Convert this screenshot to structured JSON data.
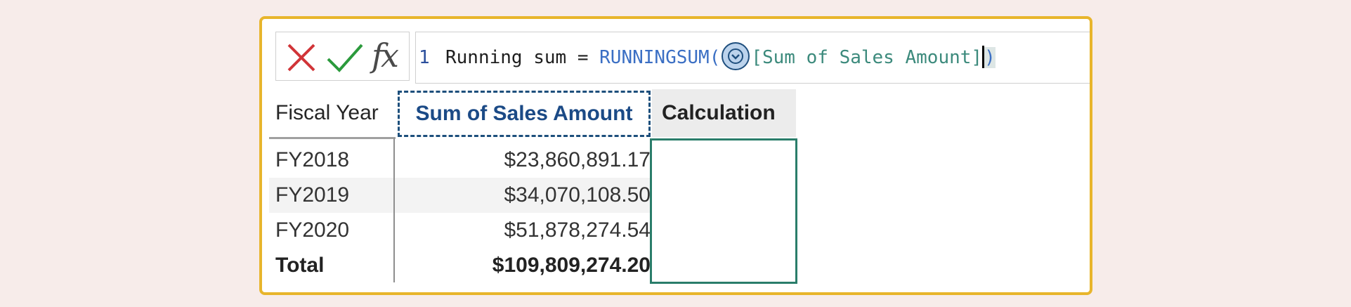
{
  "formula_bar": {
    "line_number": "1",
    "measure_name": "Running sum = ",
    "function_name": "RUNNINGSUM(",
    "argument": "[Sum of Sales Amount]",
    "close_paren": ")",
    "cancel_icon": "x-icon",
    "commit_icon": "check-icon",
    "fx_label": "fx"
  },
  "table": {
    "headers": {
      "fiscal_year": "Fiscal Year",
      "sum": "Sum of Sales Amount",
      "calculation": "Calculation"
    },
    "rows": [
      {
        "year": "FY2018",
        "value": "$23,860,891.17"
      },
      {
        "year": "FY2019",
        "value": "$34,070,108.50"
      },
      {
        "year": "FY2020",
        "value": "$51,878,274.54"
      }
    ],
    "total": {
      "label": "Total",
      "value": "$109,809,274.20"
    }
  },
  "colors": {
    "frame": "#e8b52c",
    "accent_blue": "#1b4a86",
    "calc_border": "#2a7d6a",
    "cancel_red": "#d13438",
    "commit_green": "#2b9a3c"
  }
}
